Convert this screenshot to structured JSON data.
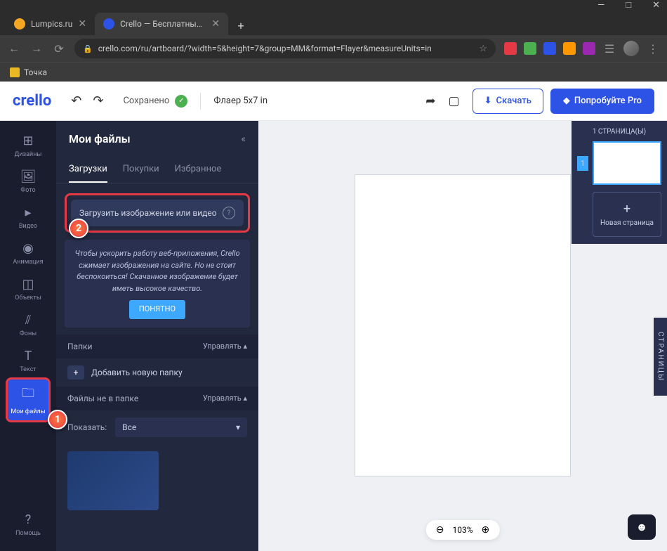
{
  "browser": {
    "tabs": [
      {
        "title": "Lumpics.ru",
        "favicon": "#f5a623"
      },
      {
        "title": "Crello — Бесплатный инструмен",
        "favicon": "#2d52e6"
      }
    ],
    "url": "crello.com/ru/artboard/?width=5&height=7&group=MM&format=Flayer&measureUnits=in",
    "bookmark": "Точка"
  },
  "header": {
    "logo": "crello",
    "saved": "Сохранено",
    "doc_title": "Флаер 5x7  in",
    "download": "Скачать",
    "pro": "Попробуйте Pro"
  },
  "nav": {
    "items": [
      {
        "icon": "⊞",
        "label": "Дизайны"
      },
      {
        "icon": "🖼",
        "label": "Фото"
      },
      {
        "icon": "▸",
        "label": "Видео"
      },
      {
        "icon": "◉",
        "label": "Анимация"
      },
      {
        "icon": "◫",
        "label": "Объекты"
      },
      {
        "icon": "⫽",
        "label": "Фоны"
      },
      {
        "icon": "T",
        "label": "Текст"
      },
      {
        "icon": "🗀",
        "label": "Мои файлы"
      }
    ],
    "help": {
      "icon": "?",
      "label": "Помощь"
    }
  },
  "sidebar": {
    "title": "Мои файлы",
    "tabs": [
      "Загрузки",
      "Покупки",
      "Избранное"
    ],
    "upload_button": "Загрузить изображение или видео",
    "info": "Чтобы ускорить работу веб-приложения, Crello сжимает изображения на сайте. Но не стоит беспокоиться! Скачанное изображение будет иметь высокое качество.",
    "ok": "ПОНЯТНО",
    "folders_label": "Папки",
    "manage": "Управлять",
    "add_folder": "Добавить новую папку",
    "files_not_in_folder": "Файлы не в папке",
    "show_label": "Показать:",
    "show_value": "Все"
  },
  "pages": {
    "header": "1 СТРАНИЦА(Ы)",
    "page_num": "1",
    "new_page": "Новая страница",
    "tab_label": "СТРАНИЦЫ"
  },
  "zoom": {
    "value": "103%"
  },
  "callouts": {
    "c1": "1",
    "c2": "2"
  }
}
